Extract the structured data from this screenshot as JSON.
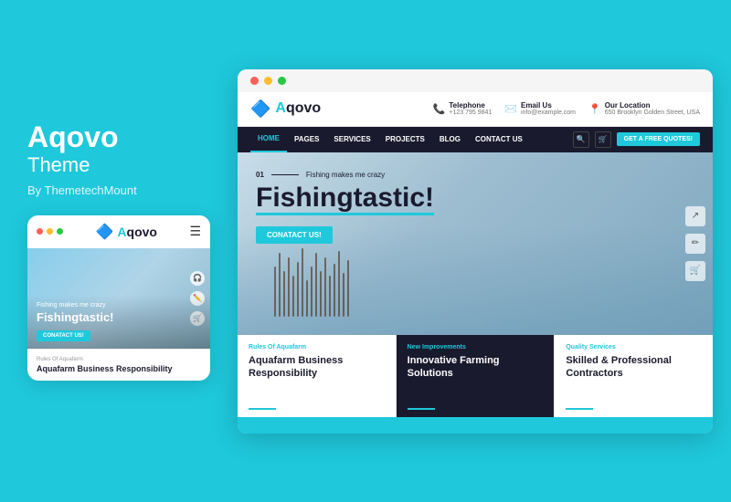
{
  "brand": {
    "title": "Aqovo",
    "subtitle": "Theme",
    "by": "By ThemetechMount"
  },
  "mobile": {
    "logo_text": "qovo",
    "hero_sub": "Fishing makes me crazy",
    "hero_title": "Fishingtastic!",
    "cta": "CONATACT US!",
    "card_label": "Rules Of Aquafarm",
    "card_title": "Aquafarm Business Responsibility"
  },
  "desktop": {
    "logo_text": "qovo",
    "contact": {
      "telephone_label": "Telephone",
      "telephone_value": "+123 795 9841",
      "email_label": "Email Us",
      "email_value": "info@example.com",
      "location_label": "Our Location",
      "location_value": "650 Brooklyn Golden Street, USA"
    },
    "nav": {
      "items": [
        "HOME",
        "PAGES",
        "SERVICES",
        "PROJECTS",
        "BLOG",
        "CONTACT US"
      ],
      "active": "HOME",
      "cta": "GET A FREE QUOTES!"
    },
    "hero": {
      "eyebrow_num": "01",
      "eyebrow_text": "Fishing makes me crazy",
      "title": "Fishingtastic!",
      "cta": "CONATACT US!"
    },
    "cards": [
      {
        "tag": "Rules Of Aquafarm",
        "title": "Aquafarm Business Responsibility",
        "highlight": false
      },
      {
        "tag": "New Improvements",
        "title": "Innovative Farming Solutions",
        "highlight": true
      },
      {
        "tag": "Quality Services",
        "title": "Skilled & Professional Contractors",
        "highlight": false
      }
    ]
  },
  "dots": {
    "red": "#ff5f57",
    "yellow": "#febc2e",
    "green": "#28c840"
  }
}
